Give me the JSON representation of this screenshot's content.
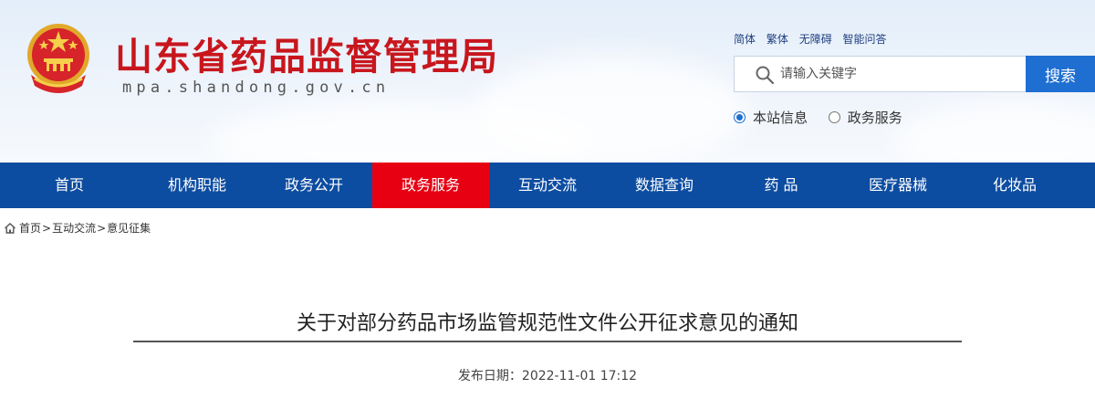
{
  "header": {
    "site_title": "山东省药品监督管理局",
    "site_domain": "mpa.shandong.gov.cn",
    "top_links": [
      "简体",
      "繁体",
      "无障碍",
      "智能问答"
    ],
    "search": {
      "placeholder": "请输入关键字",
      "value": "",
      "button_label": "搜索"
    },
    "radio_options": [
      {
        "label": "本站信息",
        "checked": true
      },
      {
        "label": "政务服务",
        "checked": false
      }
    ]
  },
  "nav": {
    "items": [
      "首页",
      "机构职能",
      "政务公开",
      "政务服务",
      "互动交流",
      "数据查询",
      "药 品",
      "医疗器械",
      "化妆品"
    ],
    "active_index": 3,
    "active_color": "#e60012",
    "bar_color": "#0d4da1"
  },
  "breadcrumb": {
    "items": [
      "首页",
      "互动交流",
      "意见征集"
    ],
    "separator": ">"
  },
  "article": {
    "title": "关于对部分药品市场监管规范性文件公开征求意见的通知",
    "publish_label": "发布日期：",
    "publish_date": "2022-11-01 17:12"
  }
}
